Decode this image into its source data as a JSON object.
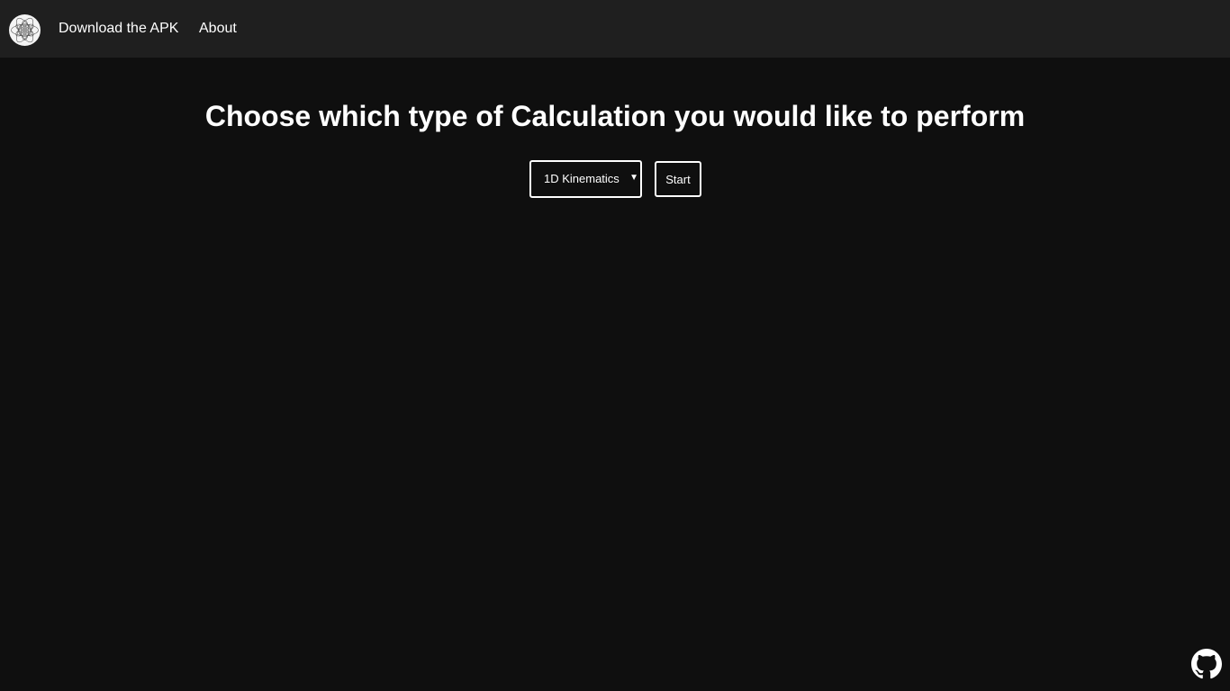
{
  "nav": {
    "logo_icon": "atom-logo-icon",
    "links": [
      {
        "label": "Download the APK"
      },
      {
        "label": "About"
      }
    ]
  },
  "main": {
    "heading": "Choose which type of Calculation you would like to perform",
    "calculation_select": {
      "selected": "1D Kinematics",
      "arrow_icon": "dropdown-arrow-icon"
    },
    "start_label": "Start"
  },
  "footer": {
    "github_icon": "github-icon"
  },
  "colors": {
    "background": "#0f0f0f",
    "navbar": "#1f1f1f",
    "text": "#ffffff"
  }
}
